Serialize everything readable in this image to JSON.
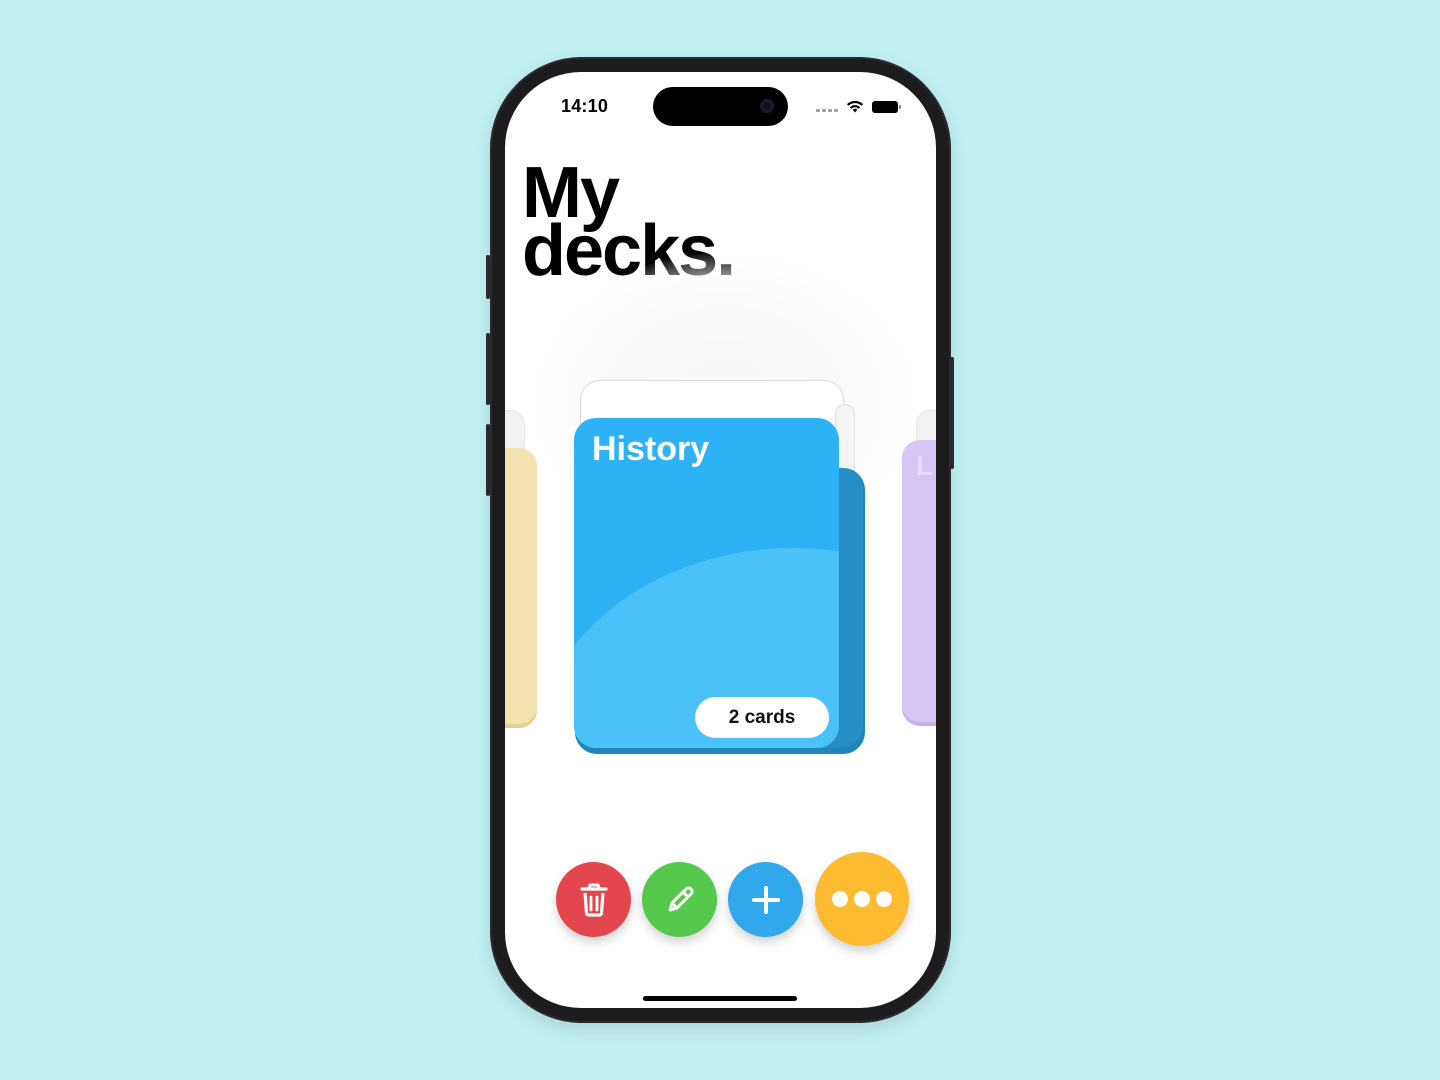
{
  "status_bar": {
    "time": "14:10"
  },
  "header": {
    "title_line1": "My",
    "title_line2": "decks."
  },
  "decks": {
    "current": {
      "name": "History",
      "count_label": "2 cards",
      "color": "#2db3f5"
    },
    "left_color": "#f3e2b2",
    "right_color": "#d6c6f6"
  },
  "actions": [
    {
      "name": "delete",
      "icon": "trash-icon",
      "color": "#e3474d"
    },
    {
      "name": "edit",
      "icon": "pencil-icon",
      "color": "#56c94d"
    },
    {
      "name": "add",
      "icon": "plus-icon",
      "color": "#2fa9ec"
    },
    {
      "name": "more",
      "icon": "more-icon",
      "color": "#fcbb30"
    }
  ],
  "background_color": "#c1f0f3"
}
